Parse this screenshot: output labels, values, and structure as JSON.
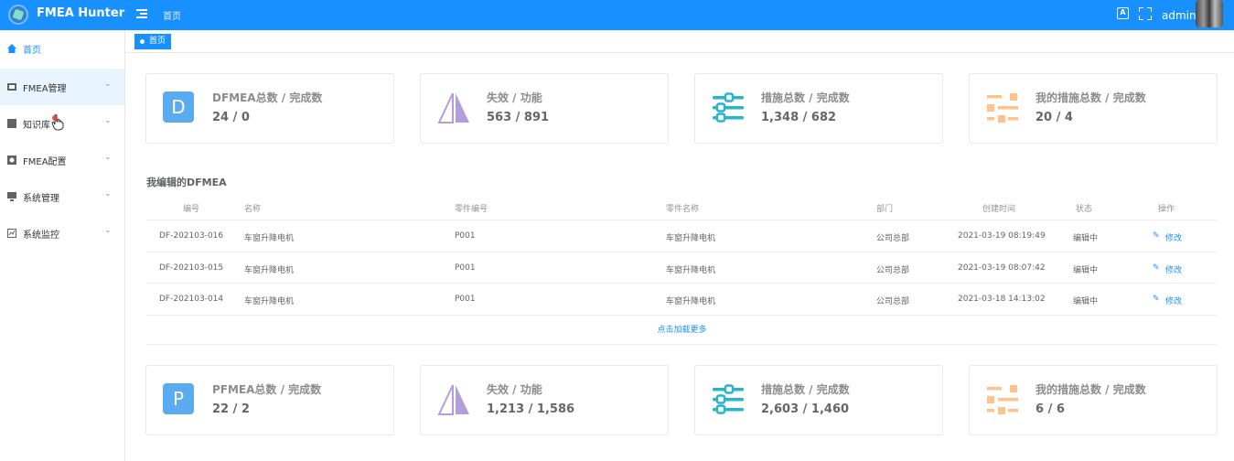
{
  "header": {
    "app_title": "FMEA Hunter",
    "breadcrumb": "首页",
    "lang_label": "A",
    "username": "admin"
  },
  "sidebar": {
    "items": [
      {
        "label": "首页"
      },
      {
        "label": "FMEA管理"
      },
      {
        "label": "知识库"
      },
      {
        "label": "FMEA配置"
      },
      {
        "label": "系统管理"
      },
      {
        "label": "系统监控"
      }
    ]
  },
  "tags": {
    "home": "首页"
  },
  "cards_top": [
    {
      "title": "DFMEA总数 / 完成数",
      "value": "24 / 0",
      "letter": "D"
    },
    {
      "title": "失效 / 功能",
      "value": "563 / 891"
    },
    {
      "title": "措施总数 / 完成数",
      "value": "1,348 / 682"
    },
    {
      "title": "我的措施总数 / 完成数",
      "value": "20 / 4"
    }
  ],
  "section": {
    "title": "我编辑的DFMEA"
  },
  "table": {
    "headers": [
      "编号",
      "名称",
      "零件编号",
      "零件名称",
      "部门",
      "创建时间",
      "状态",
      "操作"
    ],
    "rows": [
      [
        "DF-202103-016",
        "车窗升降电机",
        "P001",
        "车窗升降电机",
        "公司总部",
        "2021-03-19 08:19:49",
        "编辑中",
        "修改"
      ],
      [
        "DF-202103-015",
        "车窗升降电机",
        "P001",
        "车窗升降电机",
        "公司总部",
        "2021-03-19 08:07:42",
        "编辑中",
        "修改"
      ],
      [
        "DF-202103-014",
        "车窗升降电机",
        "P001",
        "车窗升降电机",
        "公司总部",
        "2021-03-18 14:13:02",
        "编辑中",
        "修改"
      ]
    ],
    "load_more": "点击加载更多"
  },
  "cards_bottom": [
    {
      "title": "PFMEA总数 / 完成数",
      "value": "22 / 2",
      "letter": "P"
    },
    {
      "title": "失效 / 功能",
      "value": "1,213 / 1,586"
    },
    {
      "title": "措施总数 / 完成数",
      "value": "2,603 / 1,460"
    },
    {
      "title": "我的措施总数 / 完成数",
      "value": "6 / 6"
    }
  ],
  "colors": {
    "primary": "#1890ff",
    "letter_icon": "#5aabf0",
    "triangle_icon": "#b39ddb",
    "sliders_icon": "#26b6c7",
    "list_icon": "#ffc28a"
  }
}
